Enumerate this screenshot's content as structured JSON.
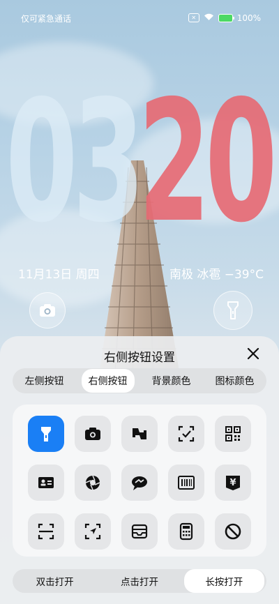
{
  "status_bar": {
    "carrier_text": "仅可紧急通话",
    "sim_icon_text": "✕",
    "battery_percent": "100%"
  },
  "clock": {
    "hour": "03",
    "minute": "20"
  },
  "date_text": "11月13日 周四",
  "weather_text": "南极 冰雹 −39°C",
  "colors": {
    "accent": "#1a7ff5",
    "minute": "#e66a74",
    "hour": "#dcecf6"
  },
  "sheet": {
    "title": "右侧按钮设置",
    "tabs": [
      {
        "label": "左侧按钮"
      },
      {
        "label": "右侧按钮",
        "active": true
      },
      {
        "label": "背景颜色"
      },
      {
        "label": "图标颜色"
      }
    ],
    "icons": [
      {
        "name": "flashlight-icon",
        "selected": true
      },
      {
        "name": "camera-icon"
      },
      {
        "name": "translate-icon"
      },
      {
        "name": "scan-check-icon"
      },
      {
        "name": "qr-code-icon"
      },
      {
        "name": "id-card-icon"
      },
      {
        "name": "aperture-icon"
      },
      {
        "name": "chat-bubble-icon"
      },
      {
        "name": "barcode-icon"
      },
      {
        "name": "yuan-icon",
        "text": "¥"
      },
      {
        "name": "scan-frame-icon"
      },
      {
        "name": "navigate-icon"
      },
      {
        "name": "tray-icon"
      },
      {
        "name": "calculator-icon"
      },
      {
        "name": "disable-icon"
      }
    ],
    "modes": [
      {
        "label": "双击打开"
      },
      {
        "label": "点击打开"
      },
      {
        "label": "长按打开",
        "active": true
      }
    ]
  }
}
